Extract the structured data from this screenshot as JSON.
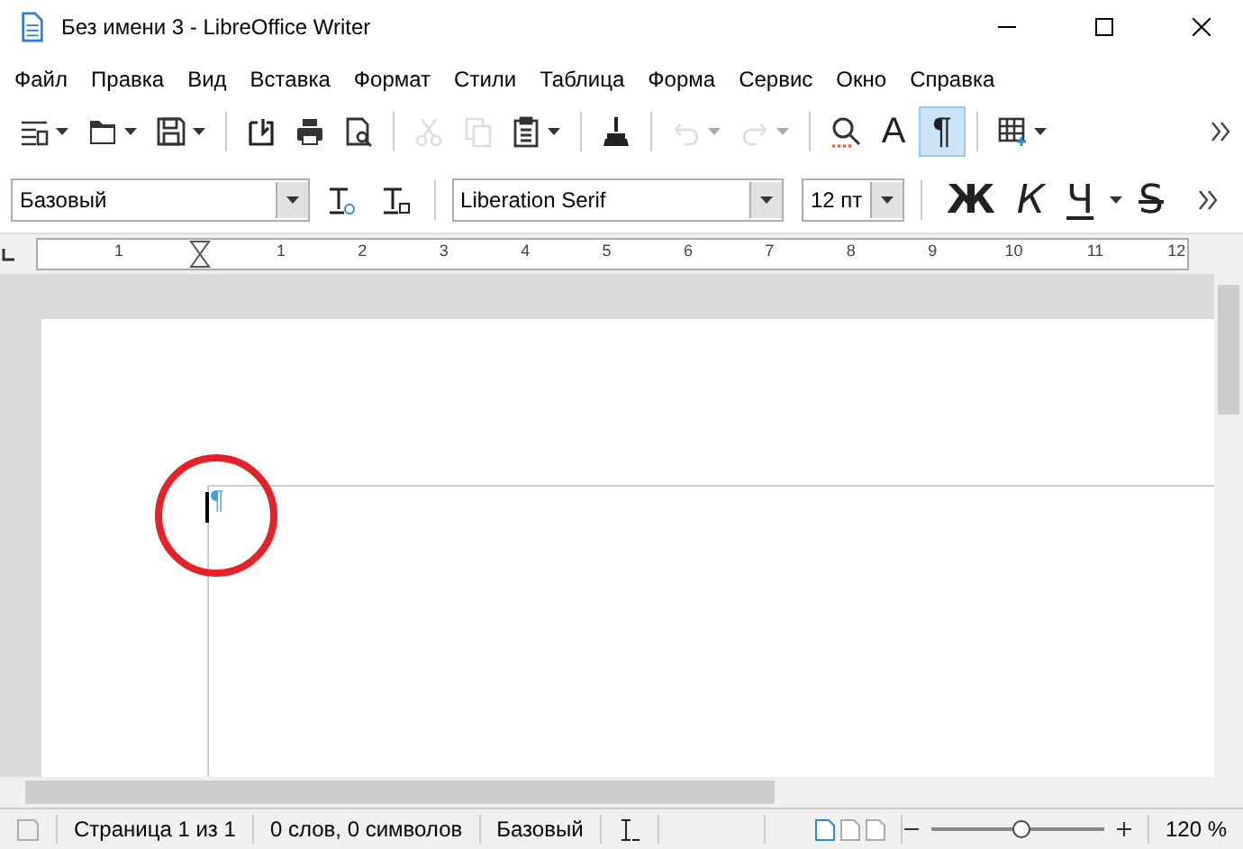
{
  "window": {
    "title": "Без имени 3 - LibreOffice Writer"
  },
  "menu": [
    "Файл",
    "Правка",
    "Вид",
    "Вставка",
    "Формат",
    "Стили",
    "Таблица",
    "Форма",
    "Сервис",
    "Окно",
    "Справка"
  ],
  "standard_toolbar": [
    {
      "kind": "sidebar",
      "selected": false,
      "disabled": false,
      "dropdown": true
    },
    {
      "kind": "folder",
      "selected": false,
      "disabled": false,
      "dropdown": true
    },
    {
      "kind": "save",
      "selected": false,
      "disabled": false,
      "dropdown": true
    },
    {
      "kind": "sep"
    },
    {
      "kind": "export",
      "selected": false,
      "disabled": false,
      "dropdown": false
    },
    {
      "kind": "print",
      "selected": false,
      "disabled": false,
      "dropdown": false
    },
    {
      "kind": "preview",
      "selected": false,
      "disabled": false,
      "dropdown": false
    },
    {
      "kind": "sep"
    },
    {
      "kind": "cut",
      "selected": false,
      "disabled": true,
      "dropdown": false
    },
    {
      "kind": "copy",
      "selected": false,
      "disabled": true,
      "dropdown": false
    },
    {
      "kind": "paste",
      "selected": false,
      "disabled": false,
      "dropdown": true
    },
    {
      "kind": "sep"
    },
    {
      "kind": "brush",
      "selected": false,
      "disabled": false,
      "dropdown": false
    },
    {
      "kind": "sep"
    },
    {
      "kind": "undo",
      "selected": false,
      "disabled": true,
      "dropdown": true
    },
    {
      "kind": "redo",
      "selected": false,
      "disabled": true,
      "dropdown": true
    },
    {
      "kind": "sep"
    },
    {
      "kind": "find",
      "selected": false,
      "disabled": false,
      "dropdown": false
    },
    {
      "kind": "glyph",
      "label": "A",
      "selected": false,
      "disabled": false,
      "dropdown": false
    },
    {
      "kind": "glyph",
      "label": "¶",
      "selected": true,
      "disabled": false,
      "dropdown": false
    },
    {
      "kind": "sep"
    },
    {
      "kind": "table",
      "selected": false,
      "disabled": false,
      "dropdown": true
    },
    {
      "kind": "more"
    }
  ],
  "formatting_toolbar": {
    "paragraph_style": "Базовый",
    "font_name": "Liberation Serif",
    "font_size": "12 пт",
    "bold": "Ж",
    "italic": "К",
    "underline": "Ч",
    "strikethrough": "S"
  },
  "ruler": {
    "labels": [
      "1",
      "1",
      "2",
      "3",
      "4",
      "5",
      "6",
      "7",
      "8",
      "9",
      "10",
      "11",
      "12"
    ]
  },
  "document": {
    "paragraph_mark": "¶"
  },
  "status_bar": {
    "page": "Страница 1 из 1",
    "word_count": "0 слов, 0 символов",
    "page_style": "Базовый",
    "level": 0.52,
    "zoom": "120 %",
    "layouts": [
      {
        "selected": true
      },
      {
        "selected": false
      },
      {
        "selected": false
      }
    ]
  }
}
